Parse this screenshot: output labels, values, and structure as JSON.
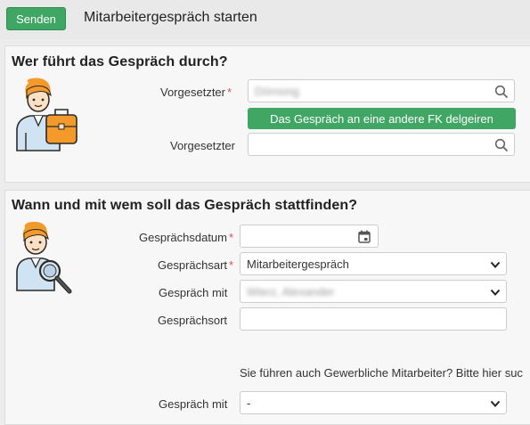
{
  "header": {
    "send_label": "Senden",
    "title": "Mitarbeitergespräch starten"
  },
  "section1": {
    "title": "Wer führt das Gespräch durch?",
    "supervisor_label": "Vorgesetzter",
    "supervisor_value": "Dörnong",
    "delegate_button": "Das Gespräch an eine andere FK delgeiren",
    "supervisor2_label": "Vorgesetzter",
    "supervisor2_value": ""
  },
  "section2": {
    "title": "Wann und mit wem soll das Gespräch stattfinden?",
    "date_label": "Gesprächsdatum",
    "date_value": "",
    "type_label": "Gesprächsart",
    "type_value": "Mitarbeitergespräch",
    "with_label": "Gespräch mit",
    "with_value": "Wierz, Alexander",
    "place_label": "Gesprächsort",
    "place_value": "",
    "info_text": "Sie führen auch Gewerbliche Mitarbeiter? Bitte hier suc",
    "with2_label": "Gespräch mit",
    "with2_value": "-"
  },
  "required_marker": "*",
  "icons": {
    "search": "search-icon",
    "dropdown": "chevron-down-icon",
    "calendar": "calendar-icon",
    "avatar1": "manager-with-briefcase-icon",
    "avatar2": "person-with-magnifier-icon"
  },
  "colors": {
    "accent_green": "#3fa663",
    "required_red": "#d9534f"
  }
}
